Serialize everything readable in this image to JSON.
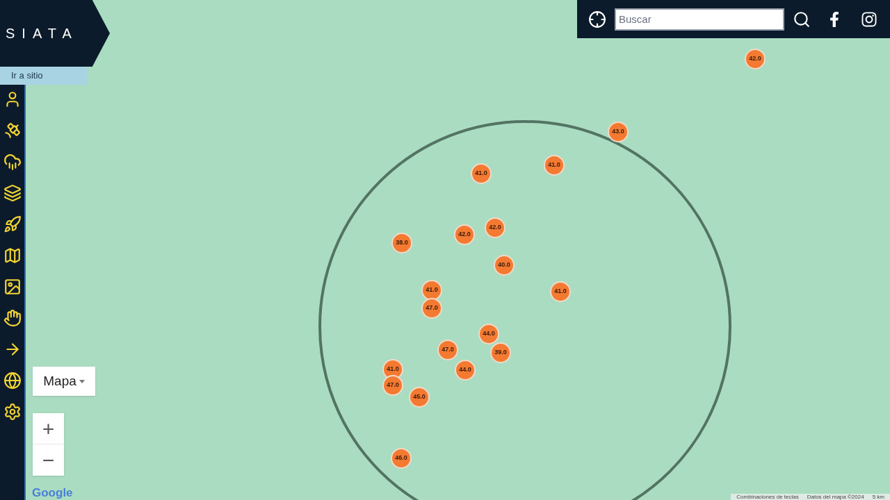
{
  "header": {
    "logo": "SIATA",
    "site_link": "Ir a sitio"
  },
  "search": {
    "placeholder": "Buscar"
  },
  "map": {
    "type_control": "Mapa",
    "zoom_in": "+",
    "zoom_out": "−",
    "logo": "Google",
    "attribution": [
      "Combinaciones de teclas",
      "Datos del mapa ©2024",
      "5 km"
    ],
    "markers": [
      {
        "value": "42.0"
      },
      {
        "value": "43.0"
      },
      {
        "value": "41.0"
      },
      {
        "value": "41.0"
      },
      {
        "value": "42.0"
      },
      {
        "value": "42.0"
      },
      {
        "value": "38.0"
      },
      {
        "value": "40.0"
      },
      {
        "value": "41.0"
      },
      {
        "value": "41.0"
      },
      {
        "value": "47.0"
      },
      {
        "value": "44.0"
      },
      {
        "value": "47.0"
      },
      {
        "value": "39.0"
      },
      {
        "value": "44.0"
      },
      {
        "value": "41.0"
      },
      {
        "value": "47.0"
      },
      {
        "value": "45.0"
      },
      {
        "value": "46.0"
      }
    ]
  }
}
